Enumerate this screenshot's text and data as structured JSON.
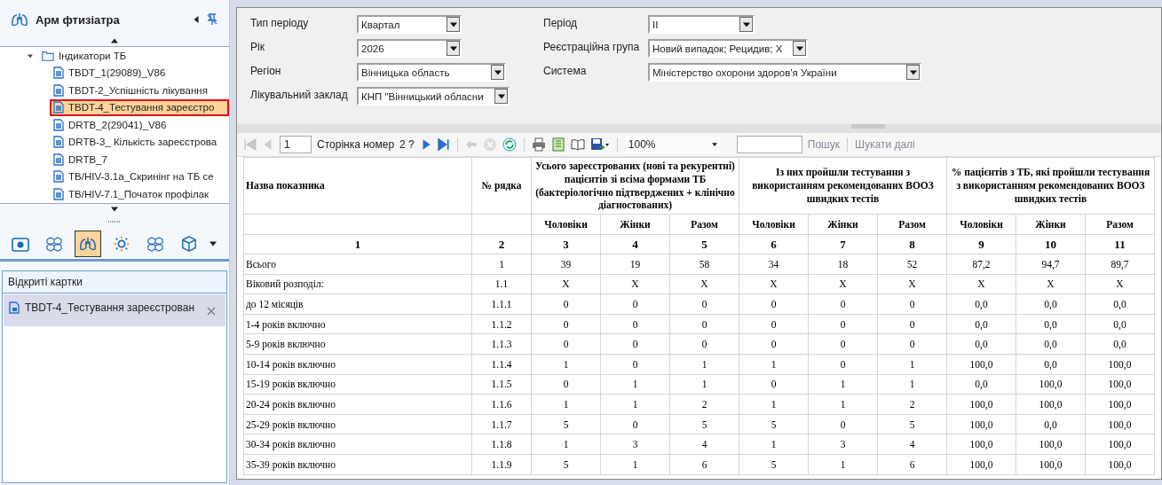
{
  "sidebar": {
    "title": "Арм фтизіатра",
    "tree": [
      {
        "label": "Індикатори ТБ",
        "expanded": true,
        "selected": false,
        "children": [
          {
            "label": "TBDT_1(29089)_V86",
            "selected": false
          },
          {
            "label": "TBDT-2_Успішність лікування",
            "selected": false
          },
          {
            "label": "TBDT-4_Тестування зареєстро",
            "selected": true
          },
          {
            "label": "DRTB_2(29041)_V86",
            "selected": false
          },
          {
            "label": "DRTB-3_ Кількість зареєстрова",
            "selected": false
          },
          {
            "label": "DRTB_7",
            "selected": false
          },
          {
            "label": "TB/HIV-3.1a_Скринінг на ТБ се",
            "selected": false
          },
          {
            "label": "TB/HIV-7.1_Початок профілак",
            "selected": false
          }
        ]
      }
    ],
    "modules": [
      {
        "kind": "folder",
        "selected": false
      },
      {
        "kind": "cubes",
        "selected": false
      },
      {
        "kind": "lungs",
        "selected": true
      },
      {
        "kind": "gear",
        "selected": false
      },
      {
        "kind": "cubes",
        "selected": false
      },
      {
        "kind": "cube",
        "selected": false
      }
    ],
    "open_cards": {
      "title": "Відкриті картки",
      "items": [
        {
          "label": "TBDT-4_Тестування зареєстрован",
          "selected": true
        }
      ]
    }
  },
  "filters": [
    {
      "label": "Тип періоду",
      "value": "Квартал"
    },
    {
      "label": "Рік",
      "value": "2026"
    },
    {
      "label": "Регіон",
      "value": "Вінницька область"
    },
    {
      "label": "Лікувальний заклад",
      "value": "КНП \"Вінницький обласни"
    },
    {
      "label": "Період",
      "value": "ІІ"
    },
    {
      "label": "Реєстраційна група",
      "value": "Новий випадок; Рецидив; Х"
    },
    {
      "label": "Система",
      "value": "Міністерство охорони здоров'я України"
    }
  ],
  "report_toolbar": {
    "page": "1",
    "page_label": "Сторінка номер",
    "page_count": "2 ?",
    "zoom": "100%",
    "search_button": "Пошук",
    "find_next": "Шукати далі"
  },
  "table": {
    "name_header": "Назва показника",
    "code_header": "№ рядка",
    "groups": [
      "Усього зареєстрованих (нові та рекурентні) пацієнтів зі всіма формами ТБ (бактеріологічно підтверджених + клінічно діагностованих)",
      "Із них пройшли тестування з використанням рекомендованих ВООЗ швидких тестів",
      "% пацієнтів з ТБ, які пройшли тестування з використанням рекомендованих ВООЗ швидких тестів"
    ],
    "subcolumns": [
      "Чоловіки",
      "Жінки",
      "Разом",
      "Чоловіки",
      "Жінки",
      "Разом",
      "Чоловіки",
      "Жінки",
      "Разом"
    ],
    "numbers": [
      "1",
      "2",
      "3",
      "4",
      "5",
      "6",
      "7",
      "8",
      "9",
      "10",
      "11"
    ],
    "rows": [
      {
        "name": "Всього",
        "code": "1",
        "values": [
          "39",
          "19",
          "58",
          "34",
          "18",
          "52",
          "87,2",
          "94,7",
          "89,7"
        ]
      },
      {
        "name": "Віковий розподіл:",
        "code": "1.1",
        "values": [
          "X",
          "X",
          "X",
          "X",
          "X",
          "X",
          "X",
          "X",
          "X"
        ]
      },
      {
        "name": "до 12 місяців",
        "code": "1.1.1",
        "values": [
          "0",
          "0",
          "0",
          "0",
          "0",
          "0",
          "0,0",
          "0,0",
          "0,0"
        ]
      },
      {
        "name": "1-4 років включно",
        "code": "1.1.2",
        "values": [
          "0",
          "0",
          "0",
          "0",
          "0",
          "0",
          "0,0",
          "0,0",
          "0,0"
        ]
      },
      {
        "name": "5-9 років включно",
        "code": "1.1.3",
        "values": [
          "0",
          "0",
          "0",
          "0",
          "0",
          "0",
          "0,0",
          "0,0",
          "0,0"
        ]
      },
      {
        "name": "10-14 років включно",
        "code": "1.1.4",
        "values": [
          "1",
          "0",
          "1",
          "1",
          "0",
          "1",
          "100,0",
          "0,0",
          "100,0"
        ]
      },
      {
        "name": "15-19 років включно",
        "code": "1.1.5",
        "values": [
          "0",
          "1",
          "1",
          "0",
          "1",
          "1",
          "0,0",
          "100,0",
          "100,0"
        ]
      },
      {
        "name": "20-24 років включно",
        "code": "1.1.6",
        "values": [
          "1",
          "1",
          "2",
          "1",
          "1",
          "2",
          "100,0",
          "100,0",
          "100,0"
        ]
      },
      {
        "name": "25-29 років включно",
        "code": "1.1.7",
        "values": [
          "5",
          "0",
          "5",
          "5",
          "0",
          "5",
          "100,0",
          "0,0",
          "100,0"
        ]
      },
      {
        "name": "30-34 років включно",
        "code": "1.1.8",
        "values": [
          "1",
          "3",
          "4",
          "1",
          "3",
          "4",
          "100,0",
          "100,0",
          "100,0"
        ]
      },
      {
        "name": "35-39 років включно",
        "code": "1.1.9",
        "values": [
          "5",
          "1",
          "6",
          "5",
          "1",
          "6",
          "100,0",
          "100,0",
          "100,0"
        ]
      }
    ]
  }
}
